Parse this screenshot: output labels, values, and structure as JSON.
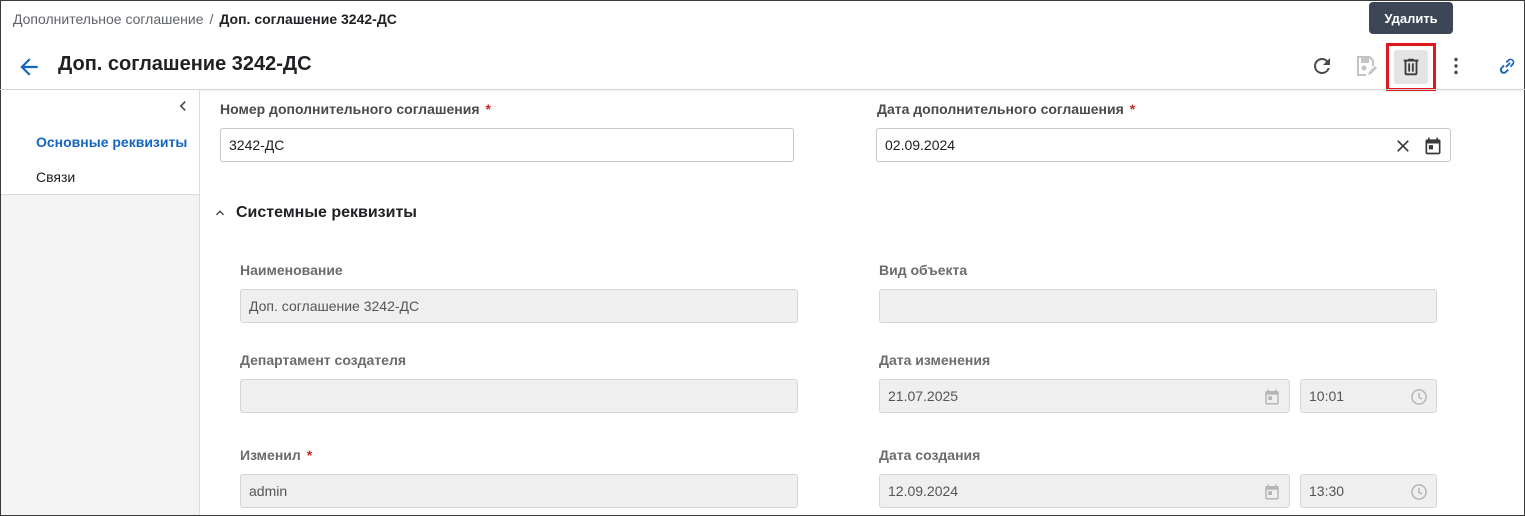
{
  "breadcrumb": {
    "parent": "Дополнительное соглашение",
    "separator": "/",
    "current": "Доп. соглашение 3242-ДС"
  },
  "header": {
    "title": "Доп. соглашение 3242-ДС",
    "tooltip": "Удалить"
  },
  "sidebar": {
    "items": [
      {
        "label": "Основные реквизиты",
        "active": true
      },
      {
        "label": "Связи",
        "active": false
      }
    ]
  },
  "main": {
    "agreement_number": {
      "label": "Номер дополнительного соглашения",
      "required": "*",
      "value": "3242-ДС"
    },
    "agreement_date": {
      "label": "Дата дополнительного соглашения",
      "required": "*",
      "value": "02.09.2024"
    }
  },
  "system_section": {
    "title": "Системные реквизиты",
    "name": {
      "label": "Наименование",
      "value": "Доп. соглашение 3242-ДС"
    },
    "object_type": {
      "label": "Вид объекта",
      "value": ""
    },
    "creator_department": {
      "label": "Департамент создателя",
      "value": ""
    },
    "modified_date": {
      "label": "Дата изменения",
      "date": "21.07.2025",
      "time": "10:01"
    },
    "modified_by": {
      "label": "Изменил",
      "required": "*",
      "value": "admin"
    },
    "created_date": {
      "label": "Дата создания",
      "date": "12.09.2024",
      "time": "13:30"
    }
  },
  "colors": {
    "accent": "#1565c0",
    "required": "#c62828",
    "highlight": "#e0181e",
    "tooltip_bg": "#3d4656"
  }
}
